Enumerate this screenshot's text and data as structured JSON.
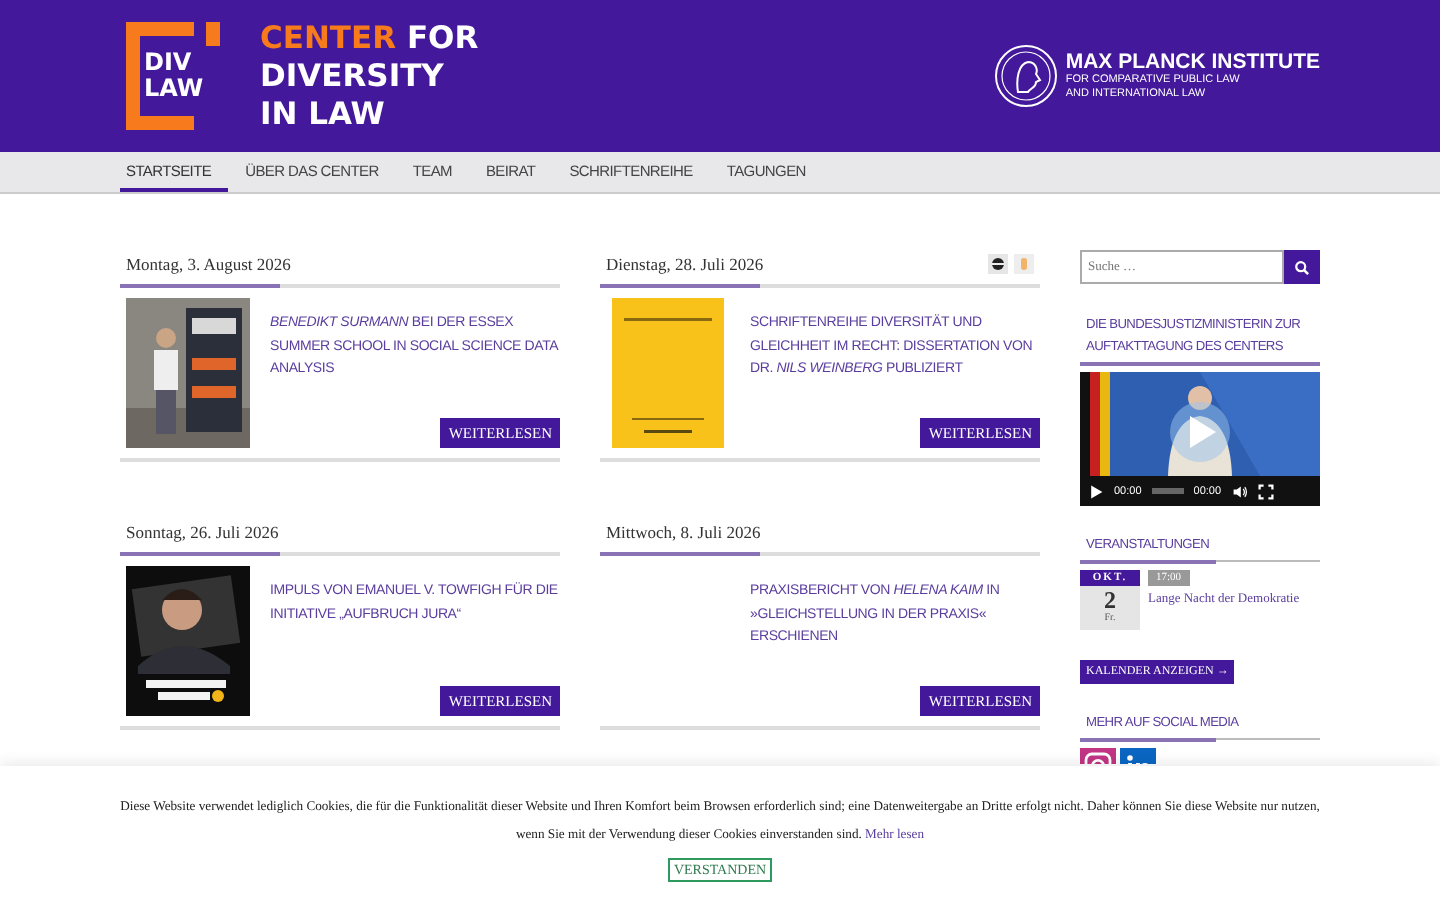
{
  "header": {
    "logo_mark": [
      "DIV",
      "LAW"
    ],
    "title_accent": "CENTER",
    "title_lines": [
      "FOR",
      "DIVERSITY",
      "IN LAW"
    ],
    "institute": {
      "name": "MAX PLANCK INSTITUTE",
      "sub": [
        "FOR COMPARATIVE PUBLIC LAW",
        "AND INTERNATIONAL LAW"
      ]
    }
  },
  "nav": [
    {
      "label": "STARTSEITE",
      "selected": true
    },
    {
      "label": "ÜBER DAS CENTER",
      "selected": false
    },
    {
      "label": "TEAM",
      "selected": false
    },
    {
      "label": "BEIRAT",
      "selected": false
    },
    {
      "label": "SCHRIFTENREIHE",
      "selected": false
    },
    {
      "label": "TAGUNGEN",
      "selected": false
    }
  ],
  "posts": [
    {
      "date": "Montag, 3. August 2026",
      "title": "*BENEDIKT SURMANN* BEI DER ESSEX SUMMER SCHOOL IN SOCIAL SCIENCE DATA ANALYSIS",
      "share_icons": false,
      "button": "WEITERLESEN"
    },
    {
      "date": "Dienstag, 28. Juli 2026",
      "title": "SCHRIFTENREIHE DIVERSITÄT UND GLEICHHEIT IM RECHT: DISSERTATION VON DR. *NILS WEINBERG* PUBLIZIERT",
      "kind": "cover",
      "share_icons": true,
      "button": "WEITERLESEN"
    },
    {
      "date": "Sonntag, 26. Juli 2026",
      "title": "IMPULS VON EMANUEL V. TOWFIGH FÜR DIE INITIATIVE „AUFBRUCH JURA“",
      "kind": "poster",
      "share_icons": false,
      "button": "WEITERLESEN"
    },
    {
      "date": "Mittwoch, 8. Juli 2026",
      "title": "PRAXISBERICHT VON *HELENA KAIM* IN »GLEICHSTELLUNG IN DER PRAXIS« ERSCHIENEN",
      "kind": "text",
      "share_icons": false,
      "button": "WEITERLESEN"
    }
  ],
  "sidebar": {
    "search": {
      "placeholder": "Suche …"
    },
    "video_widget": {
      "title": "DIE BUNDESJUSTIZMINISTERIN ZUR AUFTAKTTAGUNG DES CENTERS",
      "time_current": "00:00",
      "time_total": "00:00"
    },
    "events_widget": {
      "title": "VERANSTALTUNGEN",
      "events": [
        {
          "month": "OKT.",
          "day": "2",
          "weekday": "Fr.",
          "time": "17:00",
          "title": "Lange Nacht der Demokratie"
        }
      ],
      "button": "KALENDER ANZEIGEN →"
    },
    "social_widget": {
      "title": "MEHR AUF SOCIAL MEDIA"
    }
  },
  "cookie_banner": {
    "text": "Diese Website verwendet lediglich Cookies, die für die Funktionalität dieser Website und Ihren Komfort beim Browsen erforderlich sind; eine Datenweitergabe an Dritte erfolgt nicht. Daher können Sie diese Website nur nutzen, wenn Sie mit der Verwendung dieser Cookies einverstanden sind.",
    "link": "Mehr lesen",
    "button": "VERSTANDEN"
  }
}
